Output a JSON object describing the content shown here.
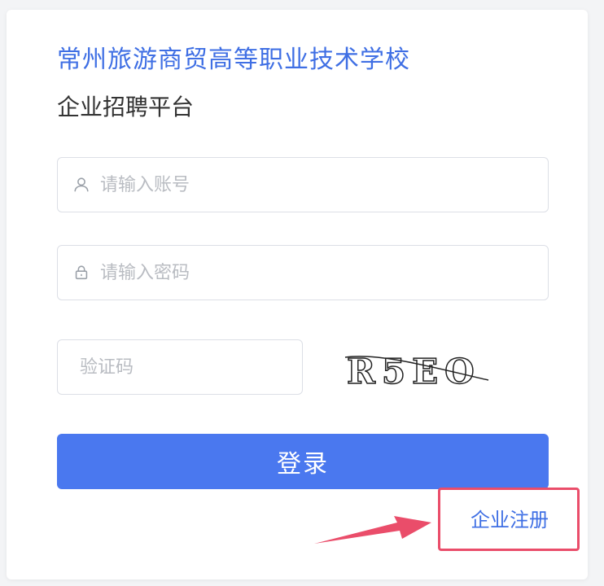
{
  "header": {
    "school_name": "常州旅游商贸高等职业技术学校",
    "platform_name": "企业招聘平台"
  },
  "login_form": {
    "account_placeholder": "请输入账号",
    "password_placeholder": "请输入密码",
    "captcha_placeholder": "验证码",
    "captcha_text": "R5EO",
    "login_label": "登录",
    "register_label": "企业注册"
  },
  "icons": {
    "account": "user-icon",
    "password": "lock-icon"
  },
  "colors": {
    "brand_blue": "#3f6fe4",
    "button_blue": "#4a78ef",
    "annotation_red": "#ea4d6a"
  }
}
